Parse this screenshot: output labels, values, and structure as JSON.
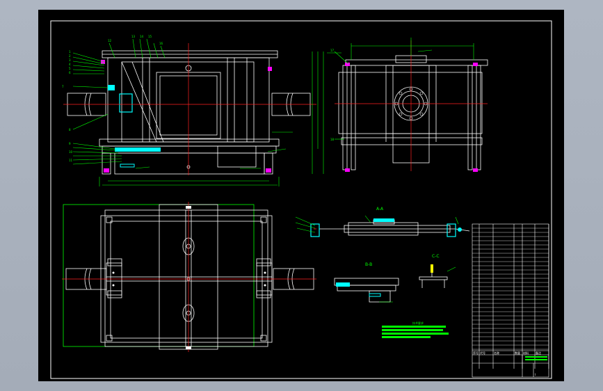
{
  "sheet": {
    "background": "#000000",
    "frame_color": "#ffffff",
    "viewport_color": "#aab2be"
  },
  "colors": {
    "outline": "#ffffff",
    "center_line": "#ff2020",
    "leader": "#00ff00",
    "cyan_part": "#00ffff",
    "magenta_part": "#ff00ff",
    "yellow_detail": "#ffff00"
  },
  "views": {
    "front": "front-elevation-view",
    "side": "side-elevation-view",
    "top": "plan-view",
    "section_assembly": "section-assembly-view",
    "detail_a": "detail-view-lower",
    "detail_b": "detail-view-hook"
  },
  "labels": {
    "section_top": "A-A",
    "section_mid": "B-B",
    "section_right": "C-C",
    "notes_title": "技术要求",
    "block_title": "I"
  },
  "title_block": {
    "header": [
      "序号",
      "代号",
      "名称",
      "数量",
      "材料",
      "备注"
    ]
  }
}
